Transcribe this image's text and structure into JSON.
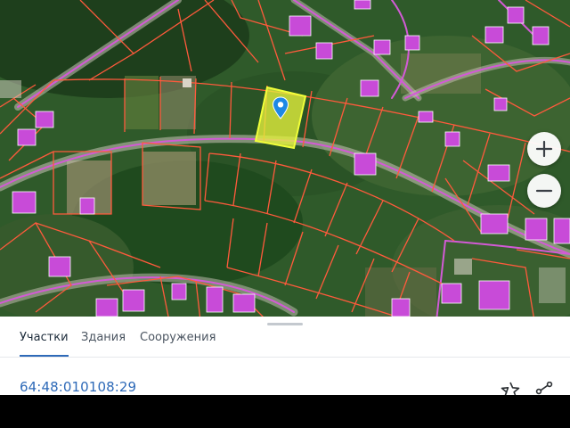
{
  "map": {
    "layer": "satellite",
    "selected_plot_color": "#e6f23c",
    "boundary_color": "#ff5a3c",
    "road_color": "#d35ad6",
    "building_color": "#c84bd8",
    "marker_icon": "location-pin-icon",
    "marker_color": "#1e88e5"
  },
  "controls": {
    "zoom_in_icon": "plus-icon",
    "zoom_out_icon": "minus-icon"
  },
  "tabs": [
    {
      "label": "Участки",
      "active": true
    },
    {
      "label": "Здания",
      "active": false
    },
    {
      "label": "Сооружения",
      "active": false
    }
  ],
  "plot": {
    "cadastral_number": "64:48:010108:29"
  },
  "actions": {
    "favorite_icon": "star-icon",
    "share_icon": "share-icon"
  }
}
